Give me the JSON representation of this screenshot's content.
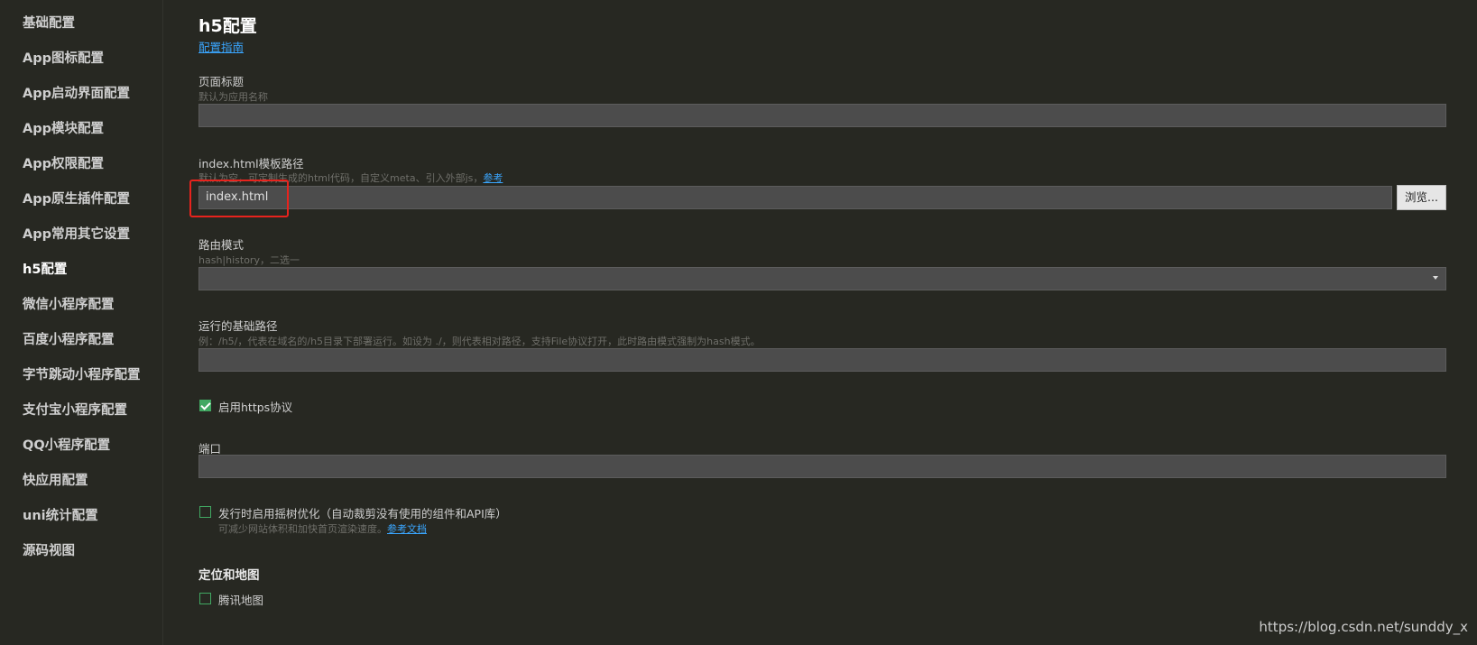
{
  "sidebar": {
    "items": [
      {
        "label": "基础配置",
        "active": false
      },
      {
        "label": "App图标配置",
        "active": false
      },
      {
        "label": "App启动界面配置",
        "active": false
      },
      {
        "label": "App模块配置",
        "active": false
      },
      {
        "label": "App权限配置",
        "active": false
      },
      {
        "label": "App原生插件配置",
        "active": false
      },
      {
        "label": "App常用其它设置",
        "active": false
      },
      {
        "label": "h5配置",
        "active": true
      },
      {
        "label": "微信小程序配置",
        "active": false
      },
      {
        "label": "百度小程序配置",
        "active": false
      },
      {
        "label": "字节跳动小程序配置",
        "active": false
      },
      {
        "label": "支付宝小程序配置",
        "active": false
      },
      {
        "label": "QQ小程序配置",
        "active": false
      },
      {
        "label": "快应用配置",
        "active": false
      },
      {
        "label": "uni统计配置",
        "active": false
      },
      {
        "label": "源码视图",
        "active": false
      }
    ]
  },
  "main": {
    "title": "h5配置",
    "guide_link": "配置指南",
    "page_title_field": {
      "label": "页面标题",
      "hint": "默认为应用名称",
      "value": ""
    },
    "template_field": {
      "label": "index.html模板路径",
      "hint": "默认为空，可定制生成的html代码，自定义meta、引入外部js，",
      "hint_link": "参考",
      "value": "index.html",
      "browse_label": "浏览..."
    },
    "router_field": {
      "label": "路由模式",
      "hint": "hash|history，二选一",
      "value": ""
    },
    "base_path_field": {
      "label": "运行的基础路径",
      "hint": "例：/h5/，代表在域名的/h5目录下部署运行。如设为 ./，则代表相对路径，支持File协议打开，此时路由模式强制为hash模式。",
      "value": ""
    },
    "https_checkbox": {
      "label": "启用https协议",
      "checked": true
    },
    "port_field": {
      "label": "端口",
      "value": ""
    },
    "treeshake_checkbox": {
      "label": "发行时启用摇树优化（自动裁剪没有使用的组件和API库）",
      "checked": false,
      "hint": "可减少网站体积和加快首页渲染速度。",
      "hint_link": "参考文档"
    },
    "map_section": {
      "heading": "定位和地图"
    },
    "tencent_map_checkbox": {
      "label": "腾讯地图",
      "checked": false
    }
  },
  "watermark": "https://blog.csdn.net/sunddy_x",
  "colors": {
    "background": "#272822",
    "input_bg": "#4c4c4c",
    "link": "#3aa6ff",
    "checkbox": "#41a862",
    "highlight": "#e8231d"
  }
}
